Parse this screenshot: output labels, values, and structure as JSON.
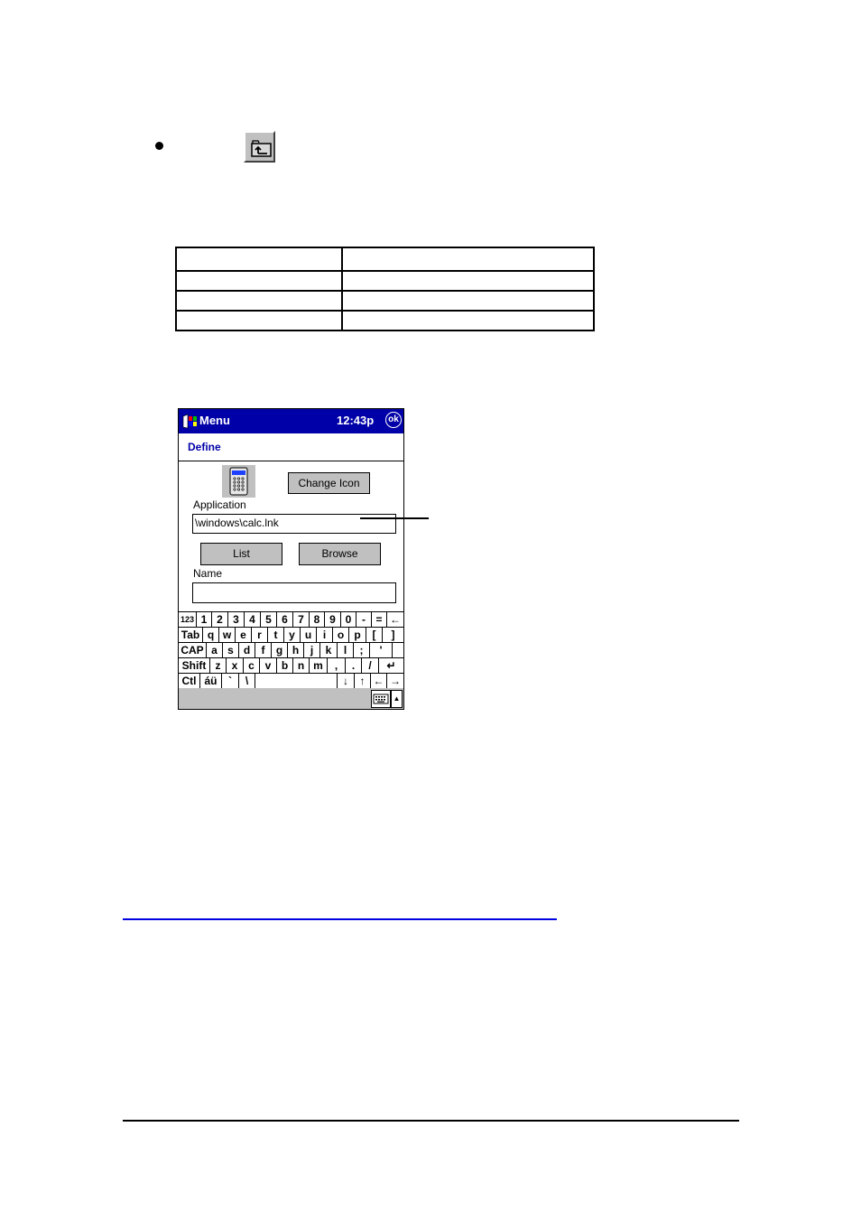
{
  "toolbar_icon": {
    "name": "folder-up-icon",
    "label": ""
  },
  "table": {
    "rows": [
      [
        "",
        ""
      ],
      [
        "",
        ""
      ],
      [
        "",
        ""
      ],
      [
        "",
        ""
      ]
    ]
  },
  "pda": {
    "titlebar": {
      "start_icon": "windows-flag-icon",
      "title": "Menu",
      "time": "12:43p",
      "ok_label": "ok",
      "bg_color": "#0000a8"
    },
    "header": {
      "title": "Define"
    },
    "change_icon_label": "Change Icon",
    "application_label": "Application",
    "application_value": "\\windows\\calc.lnk",
    "list_label": "List",
    "browse_label": "Browse",
    "name_label": "Name",
    "name_value": "",
    "keyboard": {
      "rows": [
        [
          "123",
          "1",
          "2",
          "3",
          "4",
          "5",
          "6",
          "7",
          "8",
          "9",
          "0",
          "-",
          "=",
          "←"
        ],
        [
          "Tab",
          "q",
          "w",
          "e",
          "r",
          "t",
          "y",
          "u",
          "i",
          "o",
          "p",
          "[",
          "]"
        ],
        [
          "CAP",
          "a",
          "s",
          "d",
          "f",
          "g",
          "h",
          "j",
          "k",
          "l",
          ";",
          "'"
        ],
        [
          "Shift",
          "z",
          "x",
          "c",
          "v",
          "b",
          "n",
          "m",
          ",",
          ".",
          "/",
          "↵"
        ],
        [
          "Ctl",
          "áü",
          "`",
          "\\",
          "",
          "↓",
          "↑",
          "←",
          "→"
        ]
      ]
    },
    "sip": {
      "keyboard_icon": "keyboard-icon",
      "arrow": "▲"
    }
  },
  "colors": {
    "link": "#0000e0",
    "title_blue": "#0000a8",
    "button_gray": "#c0c0c0"
  }
}
